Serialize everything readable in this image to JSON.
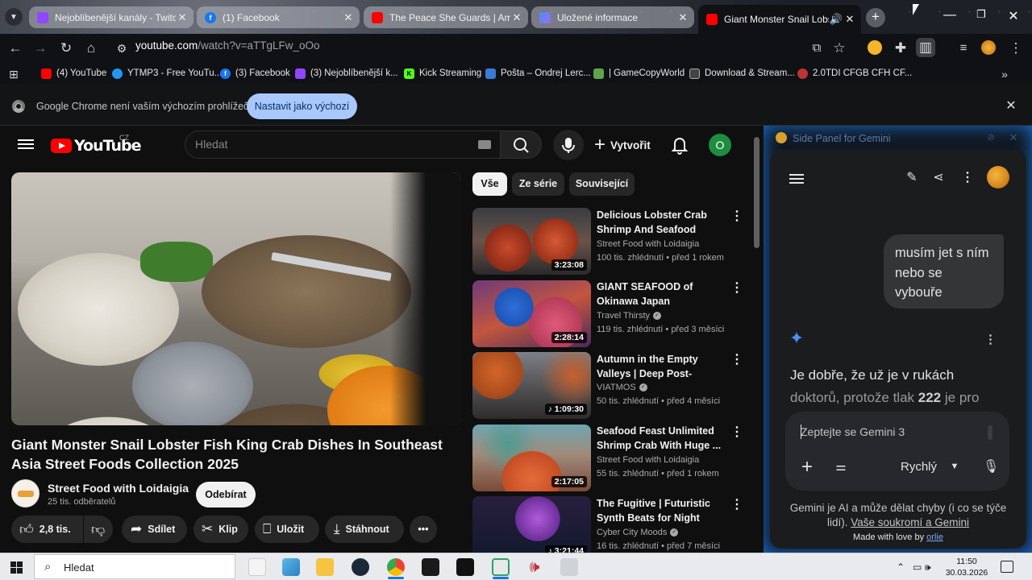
{
  "browser": {
    "tabs": [
      {
        "title": "Nejoblíbenější kanály - Twitch",
        "favicon": "twitch-icon",
        "color": "#9146ff"
      },
      {
        "title": "(1) Facebook",
        "favicon": "facebook-icon",
        "color": "#1877f2"
      },
      {
        "title": "The Peace She Guards | Ambien",
        "favicon": "youtube-icon",
        "color": "#ff0000"
      },
      {
        "title": "Uložené informace",
        "favicon": "gemini-icon",
        "color": "#4a8df6"
      },
      {
        "title": "Giant Monster Snail Lobste",
        "favicon": "youtube-icon",
        "color": "#ff0000"
      }
    ],
    "url_host": "youtube.com",
    "url_path": "/watch?v=aTTgLFw_oOo",
    "bookmarks": [
      "(4) YouTube",
      "YTMP3 - Free YouTu...",
      "(3) Facebook",
      "(3) Nejoblíbenější k...",
      "Kick Streaming",
      "Pošta – Ondrej Lerc...",
      "| GameCopyWorld",
      "Download & Stream...",
      "2.0TDI CFGB CFH CF..."
    ],
    "infobar": {
      "message": "Google Chrome není vaším výchozím prohlížečem",
      "button": "Nastavit jako výchozí"
    }
  },
  "youtube": {
    "logo_text": "YouTube",
    "country": "CZ",
    "search_placeholder": "Hledat",
    "create_label": "Vytvořit",
    "avatar_letter": "O",
    "chips": [
      "Vše",
      "Ze série",
      "Související"
    ],
    "video": {
      "title": "Giant Monster Snail Lobster Fish King Crab Dishes In Southeast Asia Street Foods Collection 2025",
      "channel": "Street Food with Loidaigia",
      "subscribers": "25 tis. odběratelů",
      "subscribe_label": "Odebírat",
      "likes": "2,8 tis.",
      "share_label": "Sdílet",
      "clip_label": "Klip",
      "save_label": "Uložit",
      "download_label": "Stáhnout"
    },
    "related": [
      {
        "title": "Delicious Lobster Crab Shrimp And Seafood Dishe...",
        "channel": "Street Food with Loidaigia",
        "meta": "100 tis. zhlédnutí • před 1 rokem",
        "duration": "3:23:08",
        "verified": false
      },
      {
        "title": "GIANT SEAFOOD of Okinawa Japan",
        "channel": "Travel Thirsty",
        "meta": "119 tis. zhlédnutí • před 3 měsíci",
        "duration": "2:28:14",
        "verified": true
      },
      {
        "title": "Autumn in the Empty Valleys | Deep Post-Apocalyptic ...",
        "channel": "VIATMOS",
        "meta": "50 tis. zhlédnutí • před 4 měsíci",
        "duration": "♪ 1:09:30",
        "verified": true
      },
      {
        "title": "Seafood Feast Unlimited Shrimp Crab With Huge ...",
        "channel": "Street Food with Loidaigia",
        "meta": "55 tis. zhlédnutí • před 1 rokem",
        "duration": "2:17:05",
        "verified": false
      },
      {
        "title": "The Fugitive | Futuristic Synth Beats for Night Drive...",
        "channel": "Cyber City Moods",
        "meta": "16 tis. zhlédnutí • před 7 měsíci",
        "duration": "♪ 3:21:44",
        "verified": true
      }
    ]
  },
  "gemini": {
    "panel_title": "Side Panel for Gemini",
    "user_message": "musím jet s ním nebo se vybouře",
    "answer_start": "Je dobře, že už je v rukách",
    "answer_line2_pre": "doktorů, protože tlak",
    "answer_bold": "222",
    "answer_line2_post": "je pro",
    "input_placeholder": "Zeptejte se Gemini 3",
    "mode": "Rychlý",
    "disclaimer": "Gemini je AI a může dělat chyby (i co se týče lidí).",
    "privacy_link": "Vaše soukromí a Gemini",
    "made_with": "Made with love by",
    "made_by": "orlie"
  },
  "taskbar": {
    "search_label": "Hledat",
    "time": "11:50",
    "date": "30.03.2026"
  }
}
